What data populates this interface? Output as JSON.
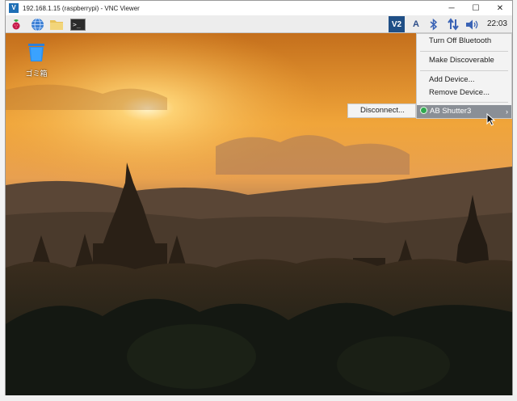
{
  "window": {
    "title": "192.168.1.15 (raspberrypi) - VNC Viewer",
    "logo_text": "V",
    "minimize": "─",
    "maximize": "☐",
    "close": "✕"
  },
  "panel": {
    "app_icons": [
      "raspberry-menu-icon",
      "web-browser-icon",
      "file-manager-icon",
      "terminal-icon"
    ],
    "terminal_glyph": ">_",
    "tray_icons": [
      "vnc-server-icon",
      "keyboard-layout-icon",
      "bluetooth-icon",
      "network-icon",
      "volume-icon"
    ],
    "vnc_tray_text": "V2",
    "keyboard_text": "A",
    "clock": "22:03"
  },
  "desktop": {
    "trash_label": "ゴミ箱"
  },
  "bluetooth_menu": {
    "turn_off": "Turn Off Bluetooth",
    "make_discoverable": "Make Discoverable",
    "add_device": "Add Device...",
    "remove_device": "Remove Device...",
    "device_name": "AB Shutter3",
    "submenu_arrow": "›"
  },
  "device_submenu": {
    "disconnect": "Disconnect..."
  },
  "colors": {
    "menu_highlight": "#8a8f96",
    "connected_dot": "#2fa84f",
    "panel_bg": "#ededed"
  }
}
